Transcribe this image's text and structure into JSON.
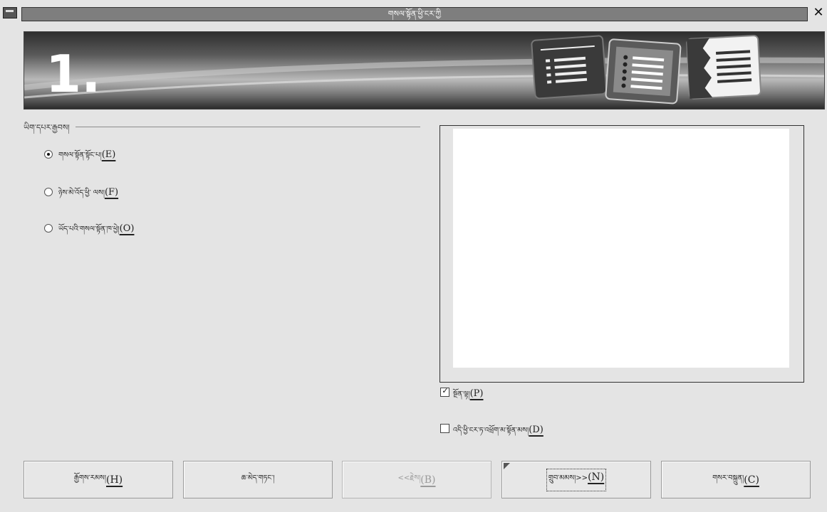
{
  "window": {
    "title": "གསལ་སྟོན་ཕྱི་ངར་ཀྱི"
  },
  "banner": {
    "step": "1."
  },
  "options_group": {
    "label": "ཡིག་དཔར་རྒྱབས།",
    "options": [
      {
        "label": "གསལ་སྟོན་སྟོང་པ།",
        "mnemonic": "(E)",
        "selected": true
      },
      {
        "label": "ཉེས་མེ་འོད་ཕྱི་ ལས།",
        "mnemonic": "(F)",
        "selected": false
      },
      {
        "label": "ཡོད་པའི་གསལ་སྟོན་ཁ་ཕྱེ།",
        "mnemonic": "(O)",
        "selected": false
      }
    ]
  },
  "preview_checkbox": {
    "label": "སྔོན་ལྟ།",
    "mnemonic": "(P)",
    "checked": true
  },
  "dont_show_checkbox": {
    "label": "འདི་ཕྱི་ངར་ཏ་འཕྲོག་མ་སྟོན་མས།",
    "mnemonic": "(D)",
    "checked": false
  },
  "buttons": {
    "help": {
      "label": "རྒྱོགས་རམས།",
      "mnemonic": "(H)"
    },
    "cancel": {
      "label": "ཆ་མེད་གཏང་།"
    },
    "back": {
      "label": "<<རྗེས།",
      "mnemonic": "(B)"
    },
    "next": {
      "label": "གྲུབ་མམས།>>",
      "mnemonic": "(N)"
    },
    "create": {
      "label": "གསར་བསྐྲུན།",
      "mnemonic": "(C)"
    }
  },
  "colors": {
    "background": "#e4e4e4",
    "title_strip": "#7e7e7e",
    "preview_bg": "#ffffff"
  }
}
